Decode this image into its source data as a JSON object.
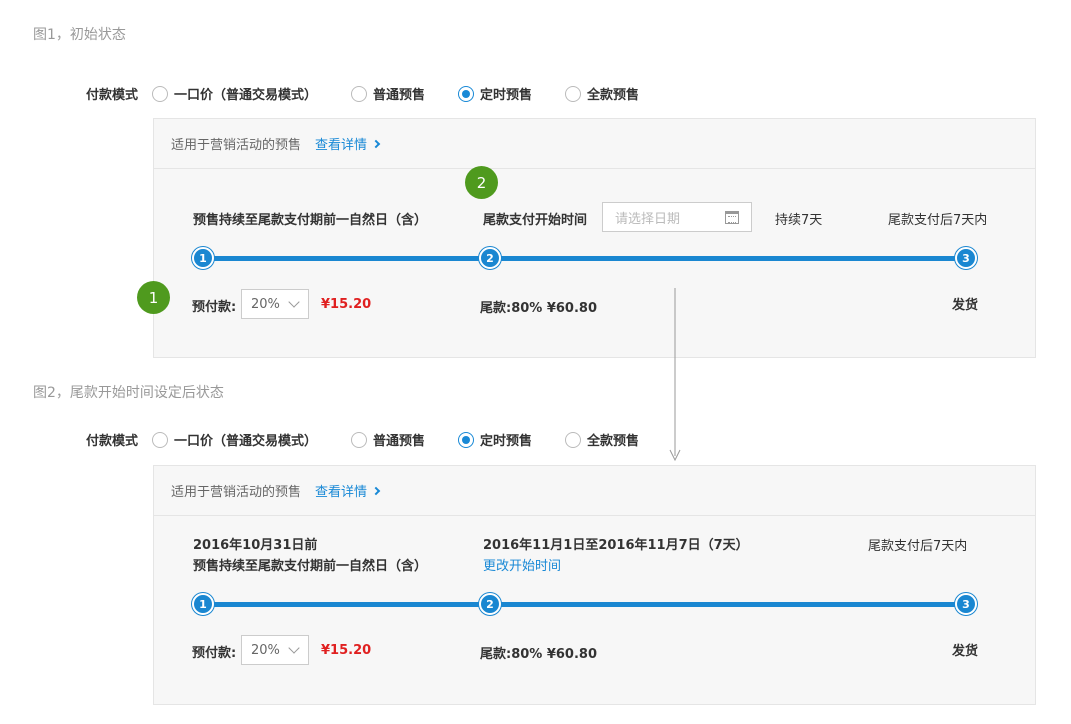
{
  "fig1": {
    "caption": "图1，初始状态",
    "payment_mode": {
      "label": "付款模式",
      "options": [
        "一口价（普通交易模式）",
        "普通预售",
        "定时预售",
        "全款预售"
      ],
      "selected_index": 2
    },
    "panel": {
      "note": "适用于营销活动的预售",
      "link": "查看详情",
      "stage1_text": "预售持续至尾款支付期前一自然日（含）",
      "stage2_label": "尾款支付开始时间",
      "date_placeholder": "请选择日期",
      "duration": "持续7天",
      "stage3_text": "尾款支付后7天内",
      "steps": [
        "1",
        "2",
        "3"
      ],
      "deposit_label": "预付款:",
      "deposit_percent": "20%",
      "deposit_amount": "¥15.20",
      "final_payment": "尾款:80%  ¥60.80",
      "ship": "发货"
    },
    "markers": [
      "1",
      "2"
    ]
  },
  "fig2": {
    "caption": "图2，尾款开始时间设定后状态",
    "payment_mode": {
      "label": "付款模式",
      "options": [
        "一口价（普通交易模式）",
        "普通预售",
        "定时预售",
        "全款预售"
      ],
      "selected_index": 2
    },
    "panel": {
      "note": "适用于营销活动的预售",
      "link": "查看详情",
      "stage1_date": "2016年10月31日前",
      "stage1_text": "预售持续至尾款支付期前一自然日（含）",
      "stage2_date": "2016年11月1日至2016年11月7日（7天）",
      "change_link": "更改开始时间",
      "stage3_text": "尾款支付后7天内",
      "steps": [
        "1",
        "2",
        "3"
      ],
      "deposit_label": "预付款:",
      "deposit_percent": "20%",
      "deposit_amount": "¥15.20",
      "final_payment": "尾款:80%  ¥60.80",
      "ship": "发货"
    }
  },
  "colors": {
    "accent": "#1989d6",
    "price": "#e02020",
    "marker": "#4f9a1e"
  }
}
